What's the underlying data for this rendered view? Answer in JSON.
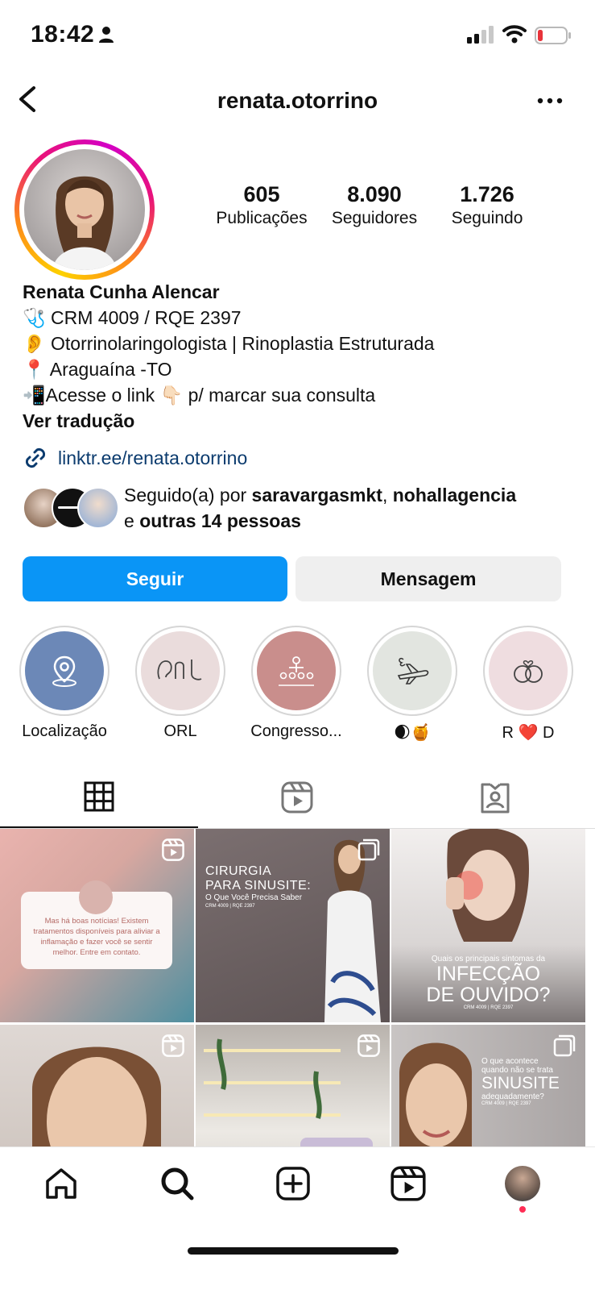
{
  "status_bar": {
    "time": "18:42"
  },
  "header": {
    "username": "renata.otorrino"
  },
  "profile": {
    "stats": [
      {
        "value": "605",
        "label": "Publicações"
      },
      {
        "value": "8.090",
        "label": "Seguidores"
      },
      {
        "value": "1.726",
        "label": "Seguindo"
      }
    ],
    "name": "Renata Cunha Alencar",
    "bio_lines": [
      "🩺 CRM 4009 / RQE 2397",
      "👂 Otorrinolaringologista | Rinoplastia Estruturada",
      "📍  Araguaína -TO",
      "📲Acesse o link 👇🏻 p/ marcar sua consulta"
    ],
    "translate": "Ver tradução",
    "link": "linktr.ee/renata.otorrino",
    "followed_by": {
      "prefix": "Seguido(a) por ",
      "user1": "saravargasmkt",
      "sep": ", ",
      "user2": "nohallagencia",
      "and": "e ",
      "others": "outras 14 pessoas"
    },
    "follow_button": "Seguir",
    "message_button": "Mensagem"
  },
  "highlights": [
    {
      "label": "Localização",
      "icon": "location-pin-icon",
      "color": "#6c88b7"
    },
    {
      "label": "ORL",
      "icon": "ear-nose-throat-icon",
      "color": "#eadcdc"
    },
    {
      "label": "Congresso...",
      "icon": "audience-icon",
      "color": "#c98e8c"
    },
    {
      "label": "🌒🍯",
      "icon": "travel-plane-icon",
      "color": "#e2e5e0"
    },
    {
      "label": "R ❤️ D",
      "icon": "rings-heart-icon",
      "color": "#efdde0"
    }
  ],
  "tabs": [
    {
      "name": "grid",
      "icon": "grid-icon",
      "active": true
    },
    {
      "name": "reels",
      "icon": "reels-icon",
      "active": false
    },
    {
      "name": "tagged",
      "icon": "tagged-icon",
      "active": false
    }
  ],
  "posts": [
    {
      "type": "reel",
      "text": "Mas há boas notícias! Existem tratamentos disponíveis para aliviar a inflamação e fazer você se sentir melhor. Entre em contato."
    },
    {
      "type": "carousel",
      "title1": "CIRURGIA",
      "title2": "PARA SINUSITE:",
      "subtitle": "O Que Você Precisa Saber",
      "crm": "CRM 4009 | RQE 2397"
    },
    {
      "type": "image",
      "question": "Quais os principais sintomas da",
      "title1": "INFECÇÃO",
      "title2": "DE OUVIDO?",
      "crm": "CRM 4009 | RQE 2397"
    },
    {
      "type": "reel"
    },
    {
      "type": "reel"
    },
    {
      "type": "carousel",
      "line1": "O que acontece",
      "line2": "quando não se trata",
      "title": "SINUSITE",
      "line3": "adequadamente?",
      "crm": "CRM 4009 | RQE 2397"
    }
  ],
  "colors": {
    "accent": "#0a95f6",
    "link": "#0b3b6e"
  }
}
